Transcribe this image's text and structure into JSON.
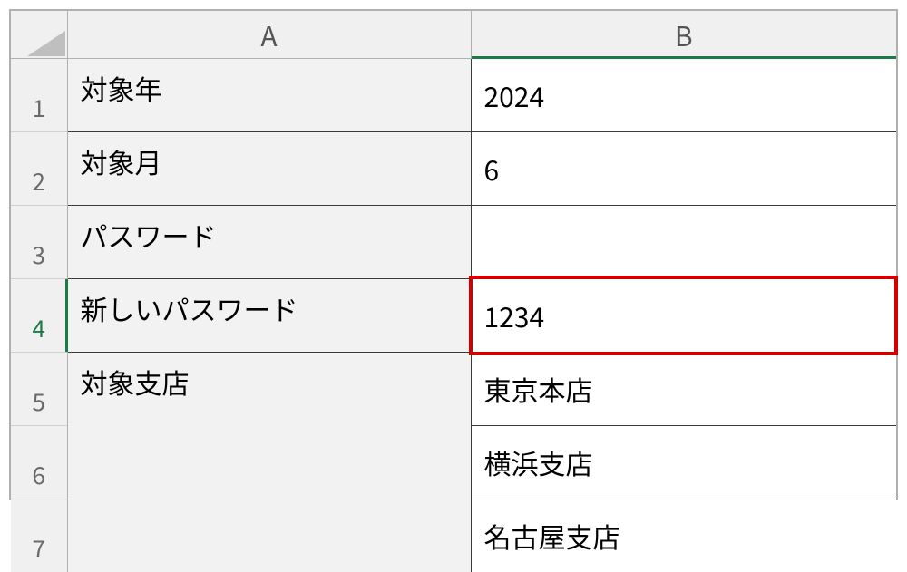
{
  "columns": {
    "A": "A",
    "B": "B"
  },
  "rownum": {
    "r1": "1",
    "r2": "2",
    "r3": "3",
    "r4": "4",
    "r5": "5",
    "r6": "6",
    "r7": "7"
  },
  "cells": {
    "A1": "対象年",
    "B1": "2024",
    "A2": "対象月",
    "B2": "6",
    "A3": "パスワード",
    "B3": "",
    "A4": "新しいパスワード",
    "B4": "1234",
    "A5": "対象支店",
    "B5": "東京本店",
    "B6": "横浜支店",
    "B7": "名古屋支店"
  }
}
